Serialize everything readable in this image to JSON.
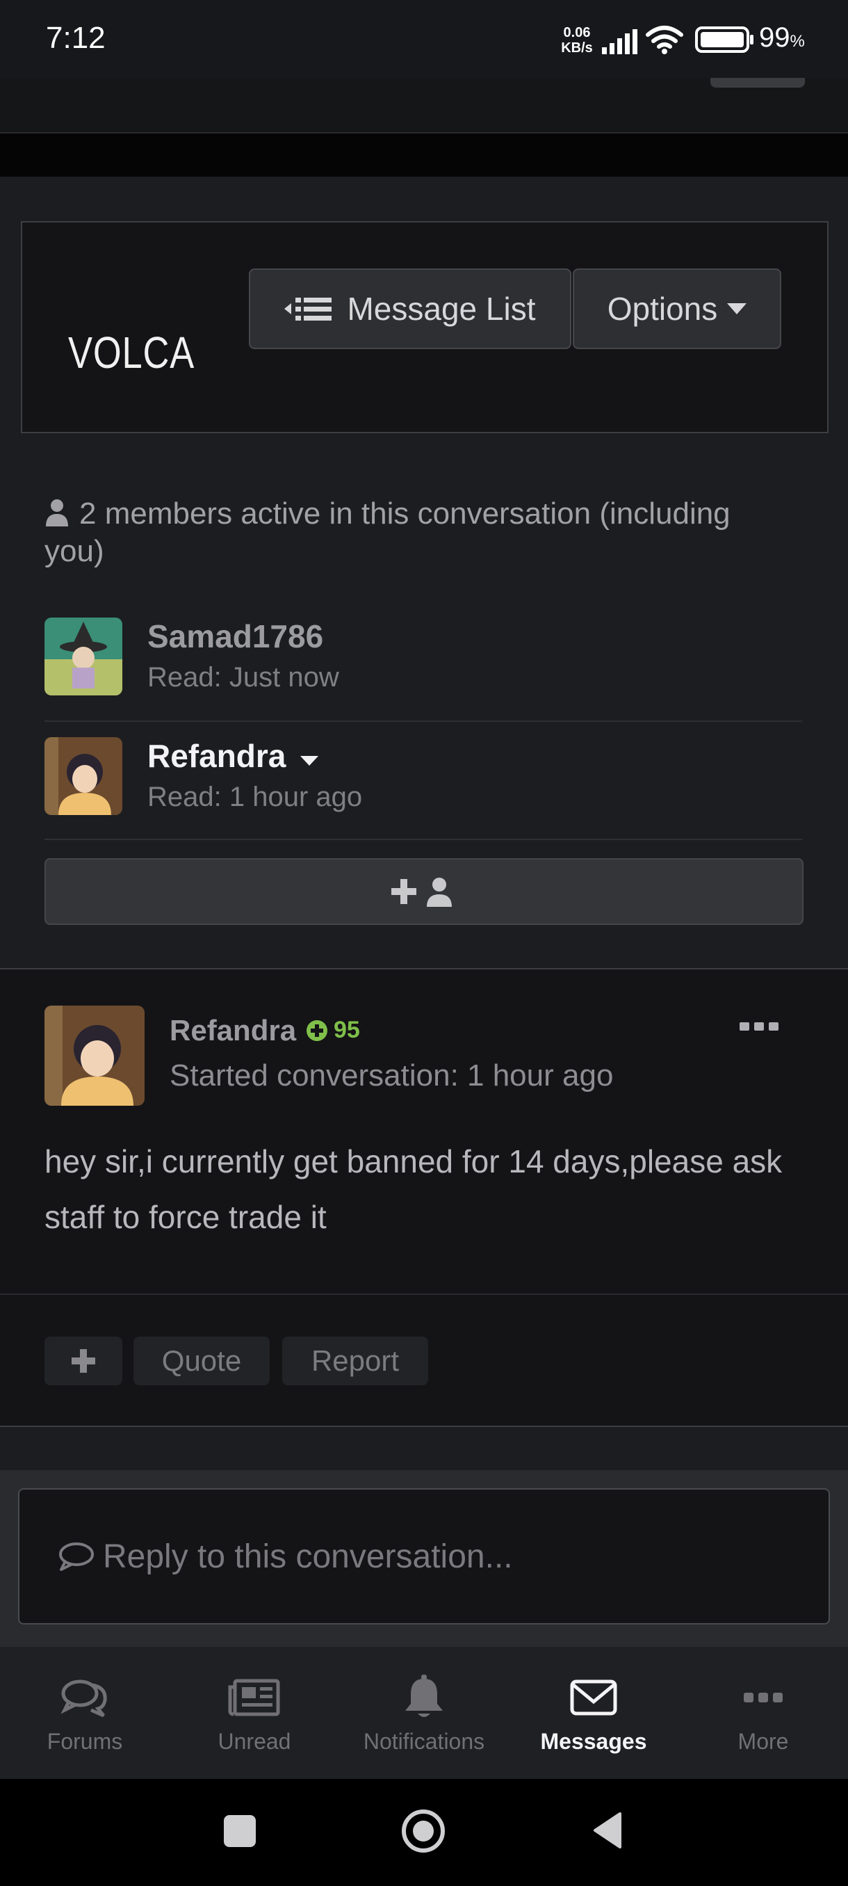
{
  "status_bar": {
    "time": "7:12",
    "speed_value": "0.06",
    "speed_unit": "KB/s",
    "battery_percent": "99",
    "battery_symbol": "%"
  },
  "header": {
    "title": "VOLCA",
    "message_list_label": "Message List",
    "options_label": "Options"
  },
  "members": {
    "summary": "2 members active in this conversation (including you)",
    "list": [
      {
        "name": "Samad1786",
        "read": "Read: Just now"
      },
      {
        "name": "Refandra",
        "read": "Read: 1 hour ago"
      }
    ]
  },
  "message": {
    "author": "Refandra",
    "reputation": "95",
    "started": "Started conversation: 1 hour ago",
    "body": "hey sir,i currently get banned for 14 days,please ask staff to force trade it",
    "actions": {
      "quote": "Quote",
      "report": "Report"
    }
  },
  "reply": {
    "placeholder": "Reply to this conversation..."
  },
  "bottom_nav": {
    "items": [
      {
        "label": "Forums",
        "icon": "forums-icon"
      },
      {
        "label": "Unread",
        "icon": "newspaper-icon"
      },
      {
        "label": "Notifications",
        "icon": "bell-icon"
      },
      {
        "label": "Messages",
        "icon": "envelope-icon"
      },
      {
        "label": "More",
        "icon": "more-icon"
      }
    ],
    "active": "Messages"
  },
  "colors": {
    "background": "#1c1d20",
    "card": "#141416",
    "reputation": "#7fbf4a",
    "active_text": "#f4f4f6"
  }
}
